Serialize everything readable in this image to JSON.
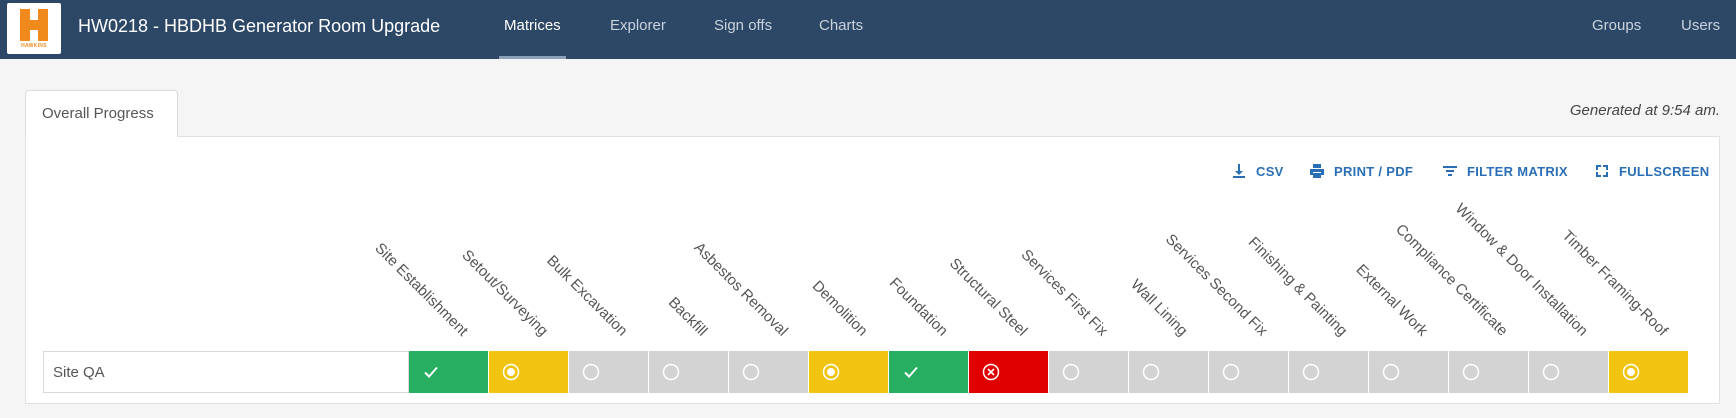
{
  "header": {
    "logo_text": "HAWKINS",
    "title": "HW0218 - HBDHB Generator Room Upgrade",
    "nav": [
      {
        "label": "Matrices",
        "active": true
      },
      {
        "label": "Explorer",
        "active": false
      },
      {
        "label": "Sign offs",
        "active": false
      },
      {
        "label": "Charts",
        "active": false
      },
      {
        "label": "Groups",
        "active": false
      },
      {
        "label": "Users",
        "active": false
      }
    ]
  },
  "tab": {
    "label": "Overall Progress"
  },
  "generated": "Generated at 9:54 am.",
  "toolbar": {
    "csv": "CSV",
    "print": "PRINT / PDF",
    "filter": "FILTER MATRIX",
    "fullscreen": "FULLSCREEN"
  },
  "matrix": {
    "columns": [
      "Site Establishment",
      "Setout/Surveying",
      "Bulk Excavation",
      "Backfill",
      "Asbestos Removal",
      "Demolition",
      "Foundation",
      "Structural Steel",
      "Services First Fix",
      "Wall Lining",
      "Services Second Fix",
      "Finishing & Painting",
      "External Work",
      "Compliance Certificate",
      "Window & Door Installation",
      "Timber Framing-Roof"
    ],
    "rows": [
      {
        "label": "Site QA",
        "statuses": [
          "complete",
          "in-progress",
          "not-started",
          "not-started",
          "not-started",
          "in-progress",
          "complete",
          "failed",
          "not-started",
          "not-started",
          "not-started",
          "not-started",
          "not-started",
          "not-started",
          "not-started",
          "in-progress"
        ]
      }
    ]
  },
  "status_colors": {
    "complete": "#27ae60",
    "in-progress": "#f1c40f",
    "not-started": "#d3d3d3",
    "failed": "#e00000"
  }
}
